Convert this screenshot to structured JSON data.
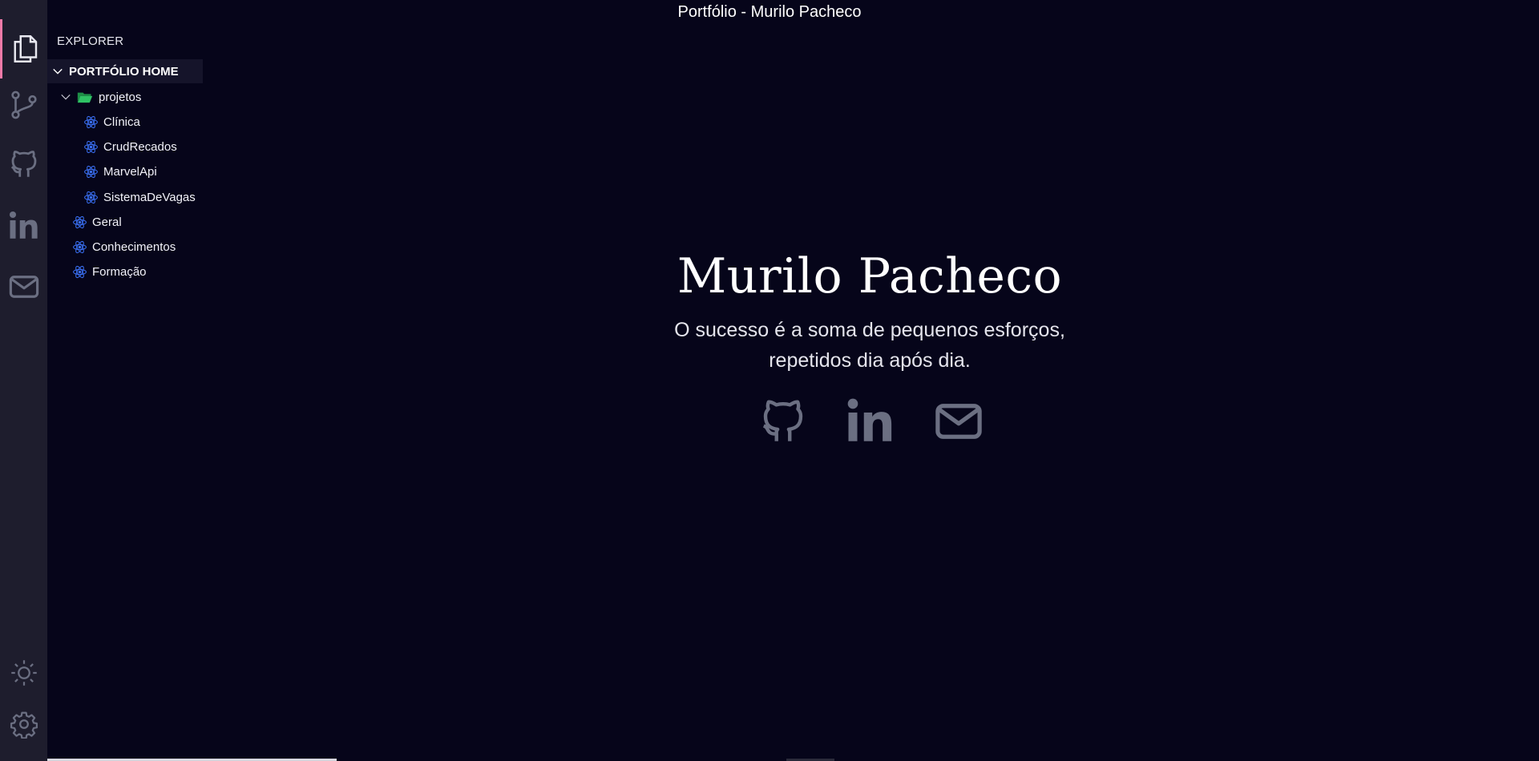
{
  "window": {
    "title": "Portfólio - Murilo Pacheco"
  },
  "activity_bar": {
    "items": [
      {
        "icon": "files-icon",
        "active": true
      },
      {
        "icon": "source-control-icon",
        "active": false
      },
      {
        "icon": "github-icon",
        "active": false
      },
      {
        "icon": "linkedin-icon",
        "active": false
      },
      {
        "icon": "mail-icon",
        "active": false
      }
    ],
    "bottom": [
      {
        "icon": "sun-icon"
      },
      {
        "icon": "gear-icon"
      }
    ]
  },
  "sidebar": {
    "title": "EXPLORER",
    "section": "PORTFÓLIO HOME",
    "folder": {
      "label": "projetos",
      "expanded": true
    },
    "folder_items": [
      "Clínica",
      "CrudRecados",
      "MarvelApi",
      "SistemaDeVagas"
    ],
    "root_items": [
      "Geral",
      "Conhecimentos",
      "Formação"
    ]
  },
  "hero": {
    "name": "Murilo Pacheco",
    "quote_line1": "O sucesso é a soma de pequenos esforços,",
    "quote_line2": "repetidos dia após dia."
  },
  "social": [
    "github-icon",
    "linkedin-icon",
    "mail-icon"
  ],
  "colors": {
    "background": "#06051a",
    "activity_bar": "#1e1d2d",
    "accent": "#f07aa8",
    "icon_gray": "#6b6f82",
    "react_blue": "#3a6ff2",
    "folder_green": "#27b35a"
  }
}
